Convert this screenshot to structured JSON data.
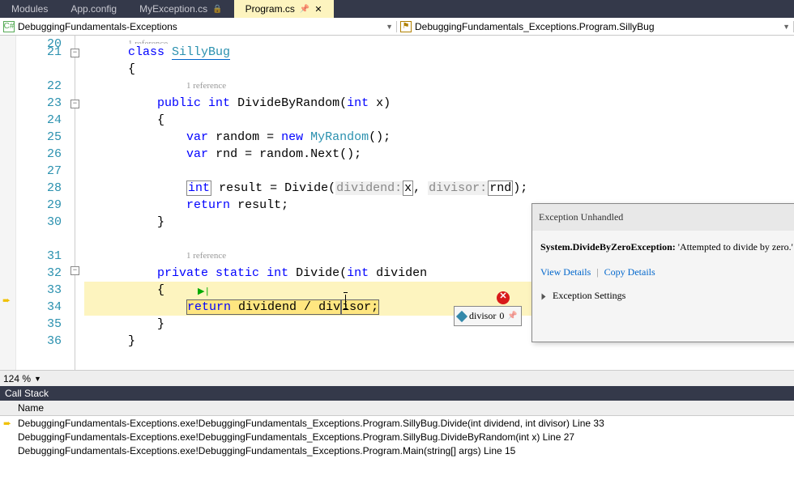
{
  "tabs": [
    {
      "label": "Modules"
    },
    {
      "label": "App.config"
    },
    {
      "label": "MyException.cs",
      "pinned": true
    },
    {
      "label": "Program.cs",
      "pinned": true,
      "active": true
    }
  ],
  "breadcrumbs": {
    "left": "DebuggingFundamentals-Exceptions",
    "right": "DebuggingFundamentals_Exceptions.Program.SillyBug"
  },
  "gutter": {
    "start": 20,
    "end": 36
  },
  "references": {
    "label": "1 reference"
  },
  "code": {
    "class_kw": "class",
    "class_name": "SillyBug",
    "public": "public",
    "int": "int",
    "method1": "DivideByRandom",
    "param_x": "x",
    "var": "var",
    "random": "random",
    "new": "new",
    "MyRandom": "MyRandom",
    "rnd": "rnd",
    "Next": "Next",
    "result": "result",
    "Divide": "Divide",
    "hint_dividend": "dividend:",
    "hint_divisor": "divisor:",
    "return": "return",
    "private": "private",
    "static": "static",
    "method2": "Divide",
    "param_dividend": "dividend",
    "ret_expr_a": "return dividend / div",
    "ret_expr_b": "isor;"
  },
  "datatip": {
    "name": "divisor",
    "value": "0"
  },
  "exception": {
    "title": "Exception Unhandled",
    "type": "System.DivideByZeroException:",
    "message": "'Attempted to divide by zero.'",
    "view_details": "View Details",
    "copy_details": "Copy Details",
    "settings": "Exception Settings"
  },
  "zoom": "124 %",
  "callstack": {
    "title": "Call Stack",
    "header": "Name",
    "rows": [
      {
        "current": true,
        "text": "DebuggingFundamentals-Exceptions.exe!DebuggingFundamentals_Exceptions.Program.SillyBug.Divide(int dividend, int divisor) Line 33"
      },
      {
        "current": false,
        "text": "DebuggingFundamentals-Exceptions.exe!DebuggingFundamentals_Exceptions.Program.SillyBug.DivideByRandom(int x) Line 27"
      },
      {
        "current": false,
        "text": "DebuggingFundamentals-Exceptions.exe!DebuggingFundamentals_Exceptions.Program.Main(string[] args) Line 15"
      }
    ]
  }
}
